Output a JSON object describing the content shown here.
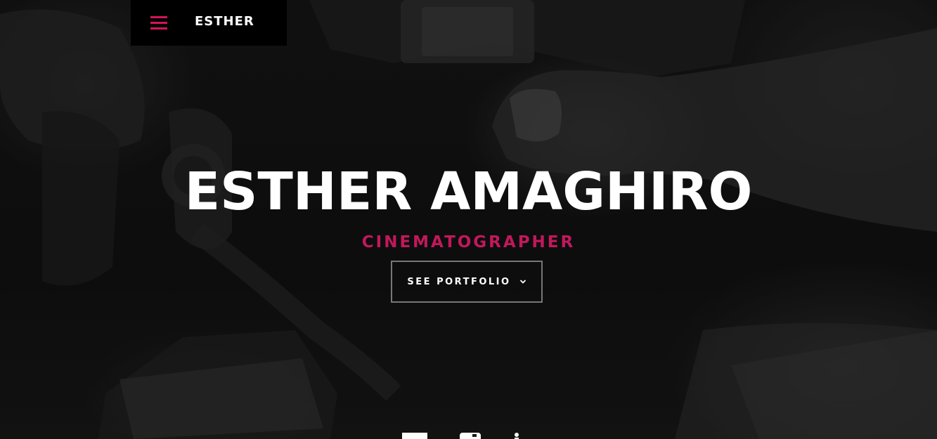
{
  "brand": {
    "name": "ESTHER",
    "menu_icon": "hamburger-menu-icon",
    "accent_color": "#d4145a"
  },
  "hero": {
    "title": "ESTHER AMAGHIRO",
    "subtitle": "CINEMATOGRAPHER",
    "cta_label": "SEE PORTFOLIO",
    "cta_icon": "chevron-down-icon",
    "background_image": "black-and-white-camera-in-hand-photo"
  },
  "socials": [
    {
      "icon": "email-icon"
    },
    {
      "icon": "instagram-icon"
    },
    {
      "icon": "linkedin-icon"
    }
  ]
}
